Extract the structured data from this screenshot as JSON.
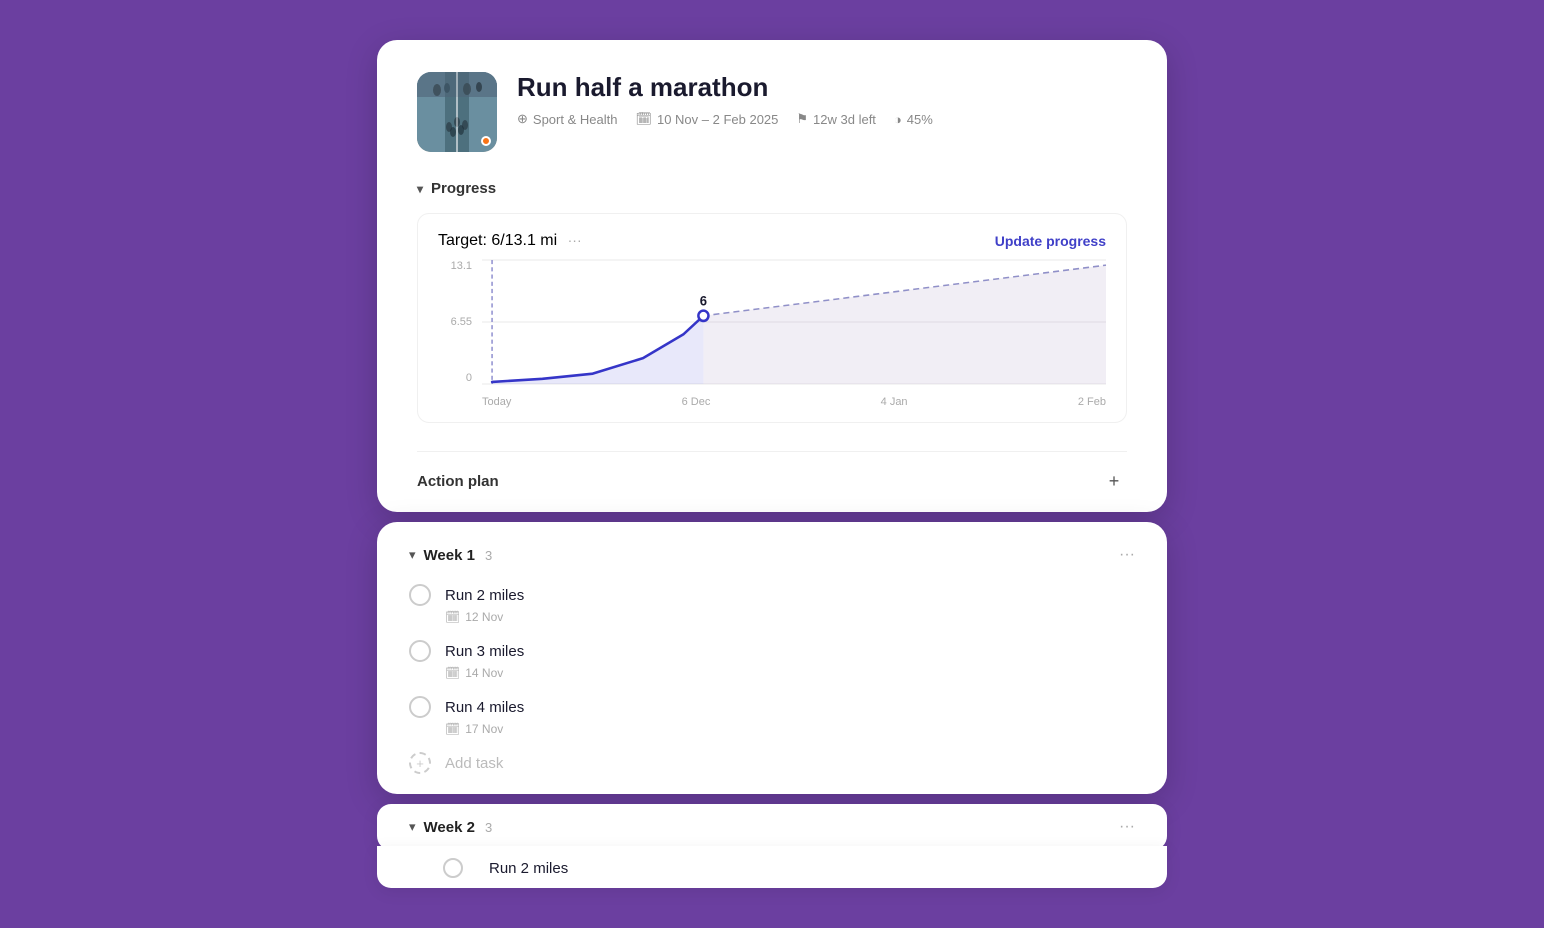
{
  "goal": {
    "title": "Run half a marathon",
    "category": "Sport & Health",
    "dates": "10 Nov – 2 Feb 2025",
    "time_left": "12w 3d left",
    "progress_pct": "45%",
    "image_alt": "marathon runners on road"
  },
  "progress": {
    "section_label": "Progress",
    "target_label": "Target: 6/13.1 mi",
    "dots_label": "···",
    "update_btn_label": "Update progress",
    "chart": {
      "y_labels": [
        "13.1",
        "6.55",
        "0"
      ],
      "x_labels": [
        "Today",
        "6 Dec",
        "4 Jan",
        "2 Feb"
      ],
      "current_value": "6",
      "data_point_x": 37,
      "data_point_y": 38
    }
  },
  "action_plan": {
    "label": "Action plan",
    "add_icon": "+"
  },
  "week1": {
    "label": "Week 1",
    "count": "3",
    "tasks": [
      {
        "name": "Run 2 miles",
        "date": "12 Nov"
      },
      {
        "name": "Run 3 miles",
        "date": "14 Nov"
      },
      {
        "name": "Run 4 miles",
        "date": "17 Nov"
      }
    ],
    "add_task_label": "Add task",
    "dots_label": "···"
  },
  "week2": {
    "label": "Week 2",
    "count": "3",
    "first_task": "Run 2 miles",
    "dots_label": "···"
  }
}
